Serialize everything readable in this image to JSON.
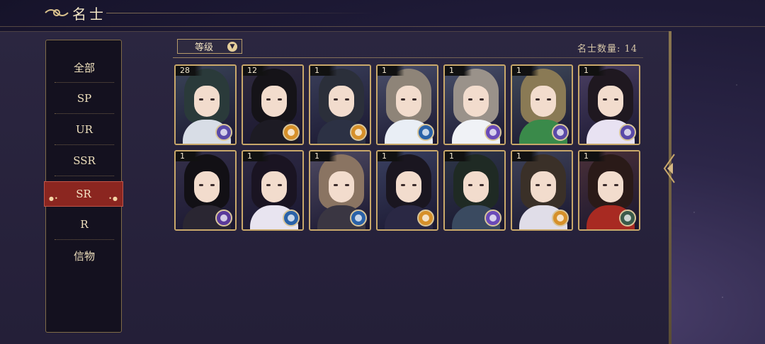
{
  "header": {
    "title": "名士"
  },
  "menu": {
    "items": [
      {
        "label": "全部"
      },
      {
        "label": "SP"
      },
      {
        "label": "UR"
      },
      {
        "label": "SSR"
      },
      {
        "label": "SR",
        "active": true
      },
      {
        "label": "R"
      },
      {
        "label": "信物"
      }
    ]
  },
  "toolbar": {
    "sort_label": "等级",
    "count_text": "名士数量: 14"
  },
  "cards": [
    {
      "level": "28",
      "hair": "#2a3a3a",
      "body": "#d8dde6",
      "bg": "#3a4458",
      "badge": "#5a4aa8"
    },
    {
      "level": "12",
      "hair": "#151318",
      "body": "#1d1b24",
      "bg": "#2f2a3e",
      "badge": "#d6902a"
    },
    {
      "level": "1",
      "hair": "#2b2f3a",
      "body": "#2c3144",
      "bg": "#3a3f5a",
      "badge": "#d6902a"
    },
    {
      "level": "1",
      "hair": "#8e8478",
      "body": "#e9eef5",
      "bg": "#4a4f6a",
      "badge": "#2a62a8"
    },
    {
      "level": "1",
      "hair": "#9a928a",
      "body": "#f0f2f6",
      "bg": "#48506a",
      "badge": "#6a4ab8"
    },
    {
      "level": "1",
      "hair": "#8a7a55",
      "body": "#3a8a4a",
      "bg": "#404a5a",
      "badge": "#5a4aa8"
    },
    {
      "level": "1",
      "hair": "#1f1820",
      "body": "#e8e2f2",
      "bg": "#4a3f62",
      "badge": "#5a4aa8"
    },
    {
      "level": "1",
      "hair": "#121015",
      "body": "#2a2632",
      "bg": "#35304a",
      "badge": "#5a3a9a"
    },
    {
      "level": "1",
      "hair": "#1a1422",
      "body": "#e8e4f0",
      "bg": "#2e2a44",
      "badge": "#2a62a8"
    },
    {
      "level": "1",
      "hair": "#8a7462",
      "body": "#3a3642",
      "bg": "#4e4a62",
      "badge": "#2a62a8"
    },
    {
      "level": "1",
      "hair": "#1a1620",
      "body": "#2a2844",
      "bg": "#3a4060",
      "badge": "#d6902a"
    },
    {
      "level": "1",
      "hair": "#1f2a24",
      "body": "#3a4a60",
      "bg": "#2e3648",
      "badge": "#6a4ab8"
    },
    {
      "level": "1",
      "hair": "#3a3028",
      "body": "#e0dde8",
      "bg": "#3e4258",
      "badge": "#d6902a"
    },
    {
      "level": "1",
      "hair": "#2a1a18",
      "body": "#a82a22",
      "bg": "#4a3038",
      "badge": "#3a5a4a"
    }
  ]
}
